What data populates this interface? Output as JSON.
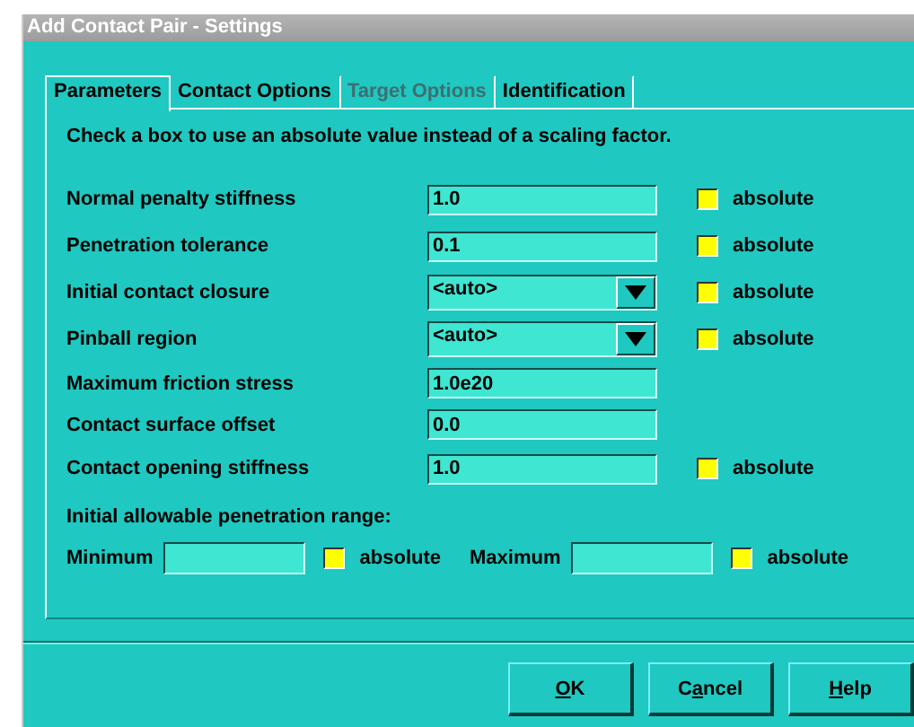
{
  "window": {
    "title": "Add Contact Pair - Settings"
  },
  "tabs": [
    {
      "label": "Parameters",
      "selected": true,
      "disabled": false
    },
    {
      "label": "Contact Options",
      "selected": false,
      "disabled": false
    },
    {
      "label": "Target Options",
      "selected": false,
      "disabled": true
    },
    {
      "label": "Identification",
      "selected": false,
      "disabled": false
    }
  ],
  "instruction": "Check a box to use an absolute value instead of a scaling factor.",
  "fields": [
    {
      "kind": "text",
      "label": "Normal penalty stiffness",
      "value": "1.0",
      "absolute": {
        "label": "absolute",
        "checked": false
      }
    },
    {
      "kind": "text",
      "label": "Penetration tolerance",
      "value": "0.1",
      "absolute": {
        "label": "absolute",
        "checked": false
      }
    },
    {
      "kind": "combo",
      "label": "Initial contact closure",
      "value": "<auto>",
      "absolute": {
        "label": "absolute",
        "checked": false
      }
    },
    {
      "kind": "combo",
      "label": "Pinball region",
      "value": "<auto>",
      "absolute": {
        "label": "absolute",
        "checked": false
      }
    },
    {
      "kind": "text",
      "label": "Maximum friction stress",
      "value": "1.0e20"
    },
    {
      "kind": "text",
      "label": "Contact surface offset",
      "value": "0.0"
    },
    {
      "kind": "text",
      "label": "Contact opening stiffness",
      "value": "1.0",
      "absolute": {
        "label": "absolute",
        "checked": false
      }
    }
  ],
  "penetration_range": {
    "heading": "Initial allowable penetration range:",
    "items": [
      {
        "label": "Minimum",
        "absolute": {
          "label": "absolute",
          "checked": false
        }
      },
      {
        "label": "Maximum",
        "absolute": {
          "label": "absolute",
          "checked": false
        }
      }
    ]
  },
  "buttons": [
    {
      "key": "O",
      "after": "K"
    },
    {
      "before": "C",
      "key": "a",
      "after": "ncel"
    },
    {
      "key": "H",
      "after": "elp"
    }
  ]
}
